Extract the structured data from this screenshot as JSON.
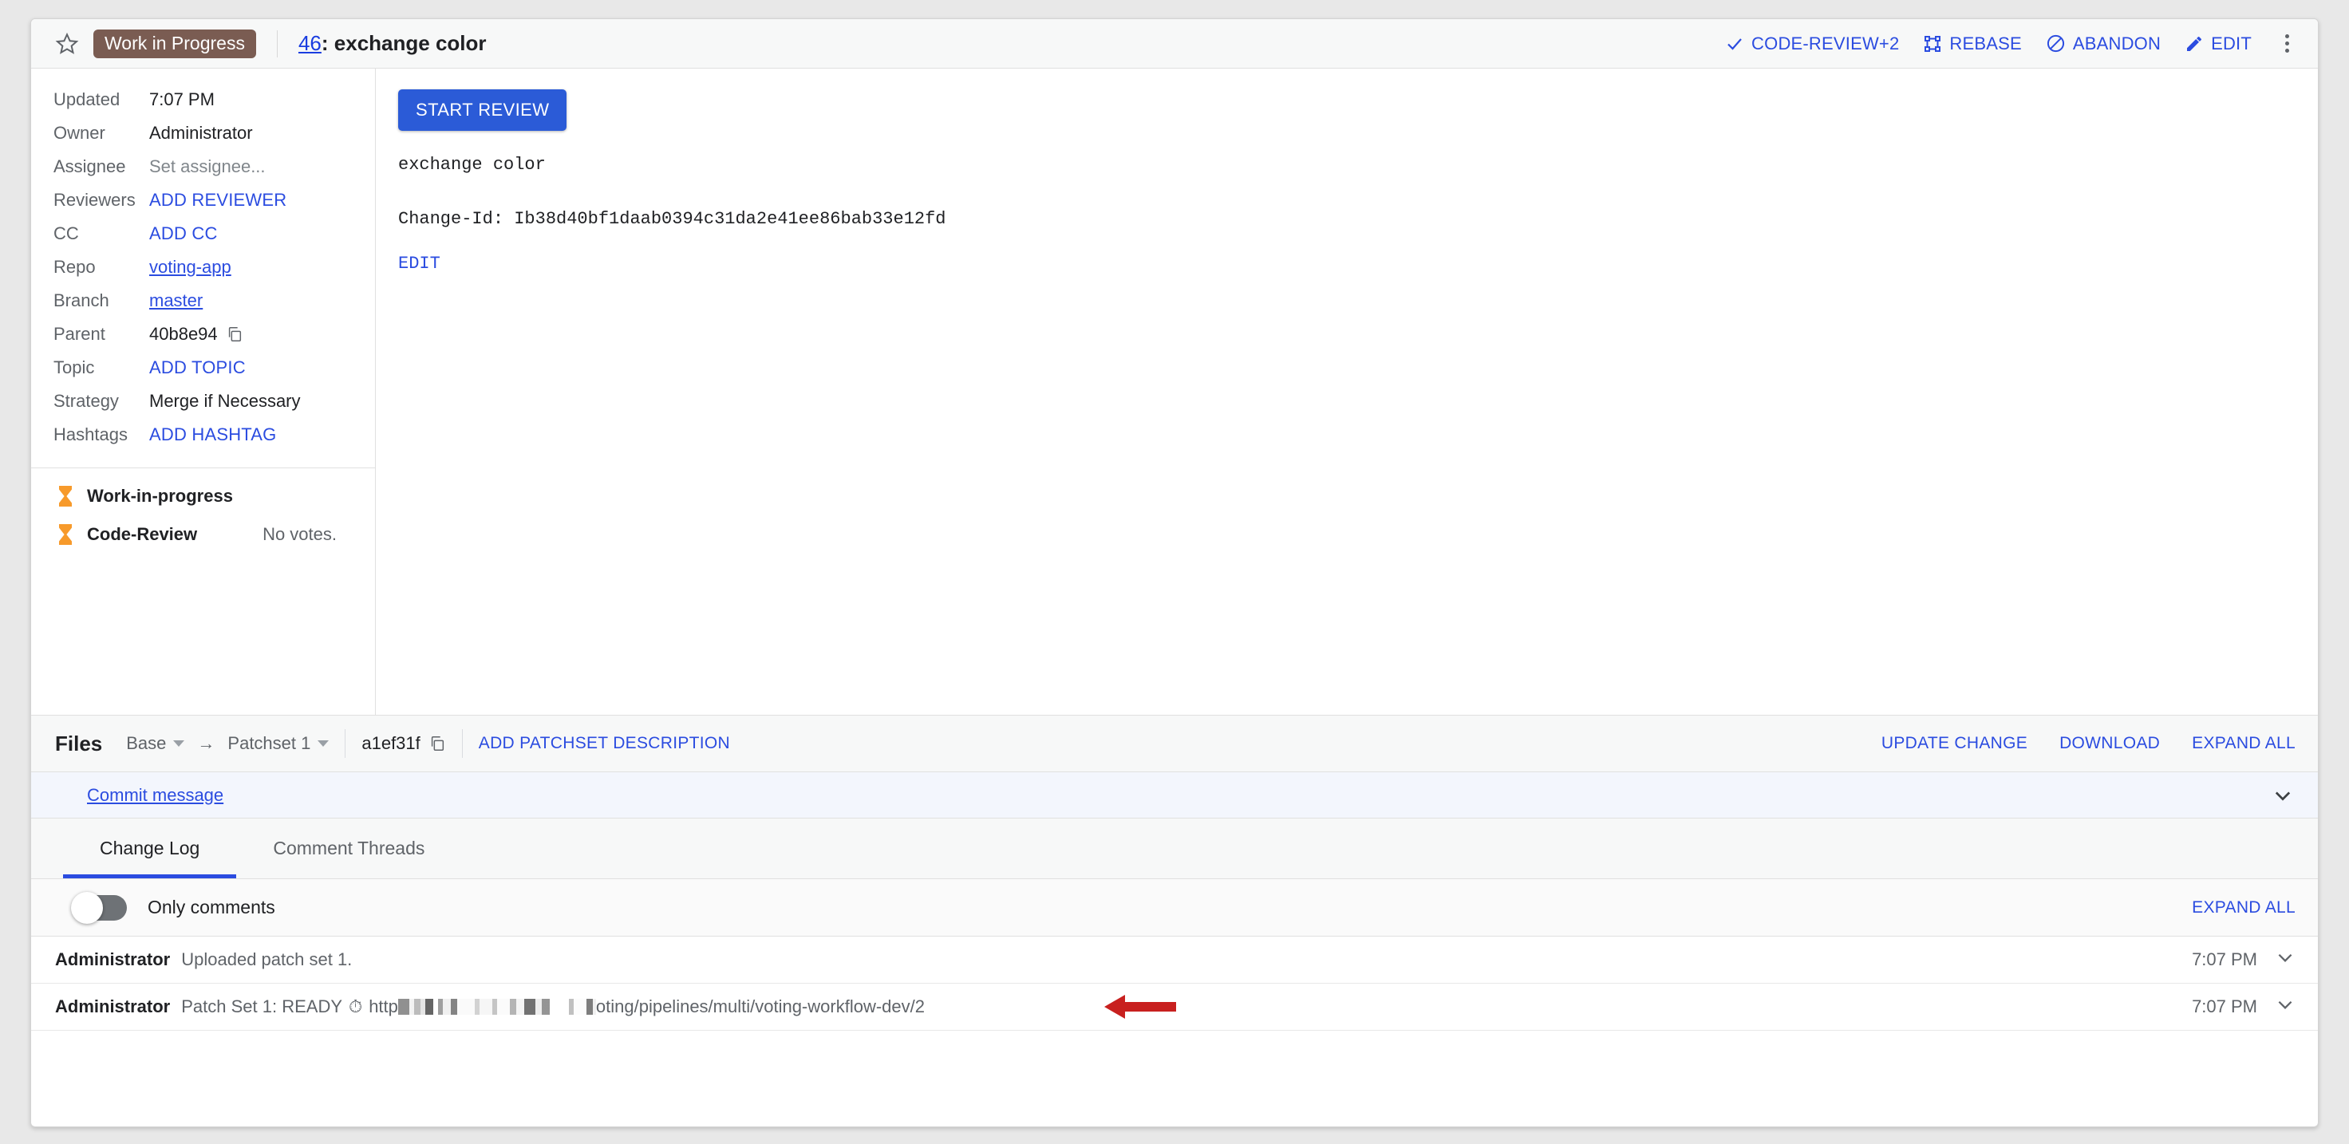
{
  "header": {
    "star_icon": "star-outline-icon",
    "wip_badge": "Work in Progress",
    "change_number": "46",
    "change_title": ": exchange color",
    "actions": [
      {
        "label": "CODE-REVIEW+2",
        "icon": "check-icon"
      },
      {
        "label": "REBASE",
        "icon": "rebase-icon"
      },
      {
        "label": "ABANDON",
        "icon": "block-icon"
      },
      {
        "label": "EDIT",
        "icon": "pencil-icon"
      }
    ],
    "overflow_icon": "kebab-menu-icon"
  },
  "metadata": {
    "rows": [
      {
        "key": "Updated",
        "value": "7:07 PM",
        "style": "plain"
      },
      {
        "key": "Owner",
        "value": "Administrator",
        "style": "plain"
      },
      {
        "key": "Assignee",
        "value": "Set assignee...",
        "style": "muted"
      },
      {
        "key": "Reviewers",
        "value": "ADD REVIEWER",
        "style": "action"
      },
      {
        "key": "CC",
        "value": "ADD CC",
        "style": "action"
      },
      {
        "key": "Repo",
        "value": "voting-app",
        "style": "link"
      },
      {
        "key": "Branch",
        "value": "master",
        "style": "link"
      },
      {
        "key": "Parent",
        "value": "40b8e94",
        "style": "copy"
      },
      {
        "key": "Topic",
        "value": "ADD TOPIC",
        "style": "action"
      },
      {
        "key": "Strategy",
        "value": "Merge if Necessary",
        "style": "plain"
      },
      {
        "key": "Hashtags",
        "value": "ADD HASHTAG",
        "style": "action"
      }
    ],
    "labels": [
      {
        "icon": "hourglass-icon",
        "name": "Work-in-progress",
        "value": ""
      },
      {
        "icon": "hourglass-icon",
        "name": "Code-Review",
        "value": "No votes."
      }
    ]
  },
  "commit": {
    "start_review_label": "START REVIEW",
    "message": "exchange color\n\nChange-Id: Ib38d40bf1daab0394c31da2e41ee86bab33e12fd",
    "edit_label": "EDIT"
  },
  "files": {
    "title": "Files",
    "base_label": "Base",
    "arrow": "→",
    "patchset_label": "Patchset 1",
    "sha": "a1ef31f",
    "copy_icon": "copy-icon",
    "add_description_label": "ADD PATCHSET DESCRIPTION",
    "right_actions": [
      "UPDATE CHANGE",
      "DOWNLOAD",
      "EXPAND ALL"
    ],
    "file_row": {
      "name": "Commit message",
      "chevron_icon": "chevron-down-icon"
    }
  },
  "tabs": [
    {
      "label": "Change Log",
      "active": true
    },
    {
      "label": "Comment Threads",
      "active": false
    }
  ],
  "log_controls": {
    "toggle_label": "Only comments",
    "toggle_on": false,
    "expand_all_label": "EXPAND ALL"
  },
  "log_entries": [
    {
      "author": "Administrator",
      "text": "Uploaded patch set 1.",
      "time": "7:07 PM",
      "chevron_icon": "chevron-down-icon",
      "has_redaction": false,
      "has_arrow": false
    },
    {
      "author": "Administrator",
      "text_prefix": "Patch Set 1: READY",
      "emoji": "⏱",
      "url_start": "http",
      "url_end": "oting/pipelines/multi/voting-workflow-dev/2",
      "time": "7:07 PM",
      "chevron_icon": "chevron-down-icon",
      "has_redaction": true,
      "has_arrow": true
    }
  ],
  "colors": {
    "accent_blue": "#2b4ce0",
    "button_blue": "#2b5bd7",
    "wip_badge": "#7a5c52",
    "hourglass_orange": "#f79a2b",
    "arrow_red": "#c8201f"
  }
}
